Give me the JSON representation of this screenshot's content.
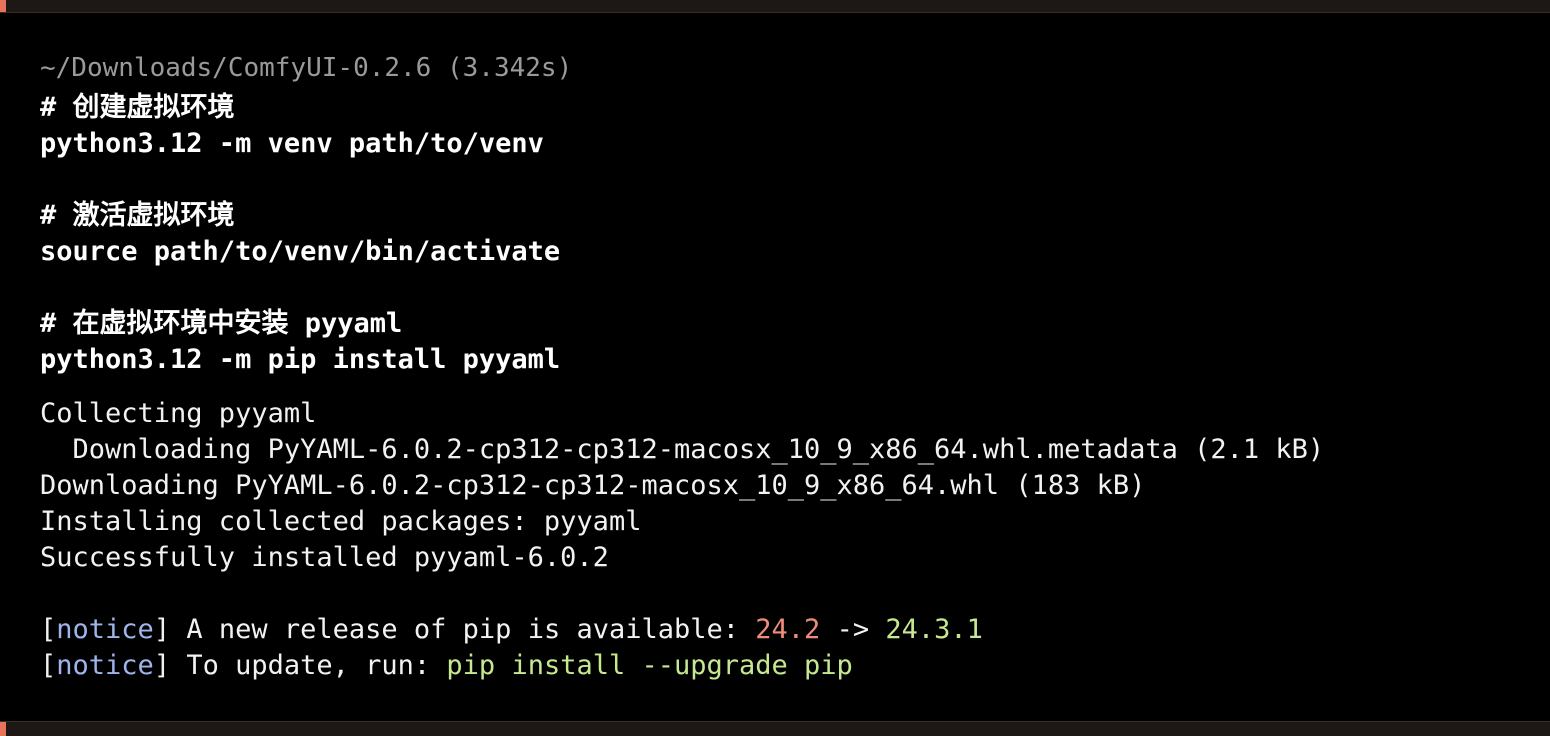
{
  "window": {
    "accent_color": "#e8735a",
    "bar_color": "#1d1715"
  },
  "prompt": {
    "path": "~/Downloads/ComfyUI-0.2.6",
    "duration": "(3.342s)"
  },
  "commands": [
    {
      "comment": "# 创建虚拟环境",
      "command": "python3.12 -m venv path/to/venv"
    },
    {
      "comment": "# 激活虚拟环境",
      "command": "source path/to/venv/bin/activate"
    },
    {
      "comment": "# 在虚拟环境中安装 pyyaml",
      "command": "python3.12 -m pip install pyyaml"
    }
  ],
  "output": {
    "collecting": "Collecting pyyaml",
    "downloading_metadata": "  Downloading PyYAML-6.0.2-cp312-cp312-macosx_10_9_x86_64.whl.metadata (2.1 kB)",
    "downloading_wheel": "Downloading PyYAML-6.0.2-cp312-cp312-macosx_10_9_x86_64.whl (183 kB)",
    "installing": "Installing collected packages: pyyaml",
    "success": "Successfully installed pyyaml-6.0.2"
  },
  "notices": {
    "tag": "notice",
    "release_text": " A new release of pip is available: ",
    "old_version": "24.2",
    "arrow": " -> ",
    "new_version": "24.3.1",
    "update_text": " To update, run: ",
    "update_command": "pip install --upgrade pip",
    "colors": {
      "tag": "#9fb4ea",
      "old_version": "#ef8c7c",
      "new_version": "#c5e890"
    }
  }
}
